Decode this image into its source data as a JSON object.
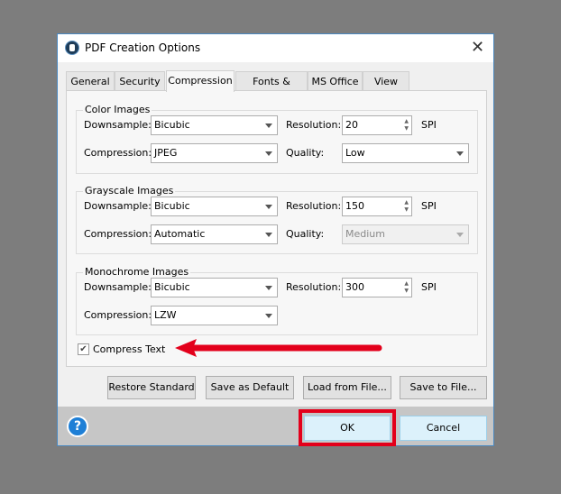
{
  "window": {
    "title": "PDF Creation Options",
    "close_icon": "close-icon",
    "app_icon": "app-logo-icon"
  },
  "tabs": [
    {
      "label": "General"
    },
    {
      "label": "Security"
    },
    {
      "label": "Compression",
      "active": true
    },
    {
      "label": "Fonts & Colors"
    },
    {
      "label": "MS Office"
    },
    {
      "label": "View"
    }
  ],
  "labels": {
    "downsample": "Downsample:",
    "compression": "Compression:",
    "resolution": "Resolution:",
    "quality": "Quality:",
    "spi": "SPI"
  },
  "color_images": {
    "title": "Color Images",
    "downsample": "Bicubic",
    "resolution": "20",
    "compression": "JPEG",
    "quality": "Low"
  },
  "grayscale_images": {
    "title": "Grayscale Images",
    "downsample": "Bicubic",
    "resolution": "150",
    "compression": "Automatic",
    "quality": "Medium",
    "quality_disabled": true
  },
  "monochrome_images": {
    "title": "Monochrome Images",
    "downsample": "Bicubic",
    "resolution": "300",
    "compression": "LZW"
  },
  "compress_text": {
    "label": "Compress Text",
    "checked": true
  },
  "buttons": {
    "restore": "Restore Standard",
    "save_default": "Save as Default",
    "load": "Load from File...",
    "save_file": "Save to File...",
    "ok": "OK",
    "cancel": "Cancel"
  },
  "annotation": {
    "color": "#e3001b"
  }
}
